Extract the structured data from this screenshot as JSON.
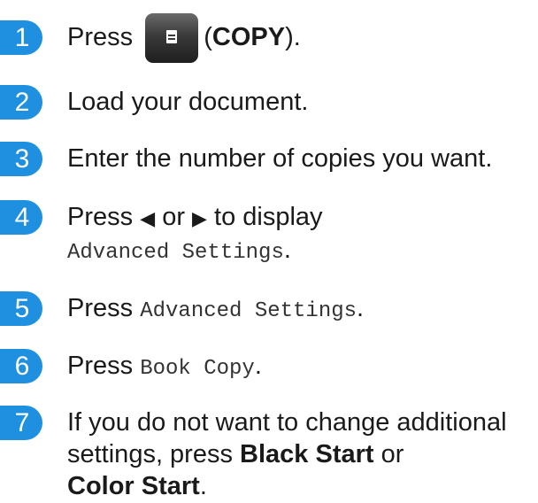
{
  "accent_color": "#1f8fe0",
  "steps": [
    {
      "num": "1",
      "press": "Press",
      "copy_button_icon": "copy-key-icon",
      "copy_label": "COPY",
      "open_paren": "(",
      "close_paren": ")."
    },
    {
      "num": "2",
      "text": "Load your document."
    },
    {
      "num": "3",
      "text": "Enter the number of copies you want."
    },
    {
      "num": "4",
      "press": "Press",
      "left_arrow": "◀",
      "or": "or",
      "right_arrow": "▶",
      "to_display": "to display",
      "setting": "Advanced Settings",
      "period": "."
    },
    {
      "num": "5",
      "press": "Press",
      "setting": "Advanced Settings",
      "period": "."
    },
    {
      "num": "6",
      "press": "Press",
      "setting": "Book Copy",
      "period": "."
    },
    {
      "num": "7",
      "line1": "If you do not want to change additional",
      "line2_pre": "settings, press",
      "black_start": "Black Start",
      "or": "or",
      "color_start": "Color Start",
      "period": "."
    }
  ]
}
